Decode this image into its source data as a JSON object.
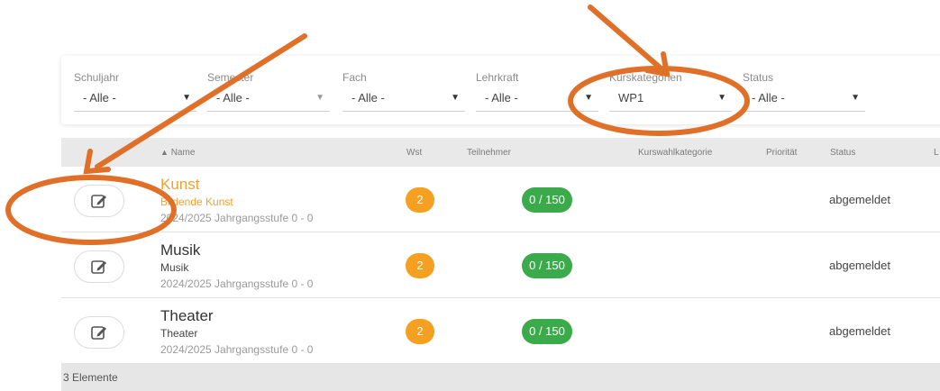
{
  "filters": [
    {
      "label": "Schuljahr",
      "value": "- Alle -"
    },
    {
      "label": "Semester",
      "value": "- Alle -"
    },
    {
      "label": "Fach",
      "value": "- Alle -"
    },
    {
      "label": "Lehrkraft",
      "value": "- Alle -"
    },
    {
      "label": "Kurskategorien",
      "value": "WP1"
    },
    {
      "label": "Status",
      "value": "- Alle -"
    }
  ],
  "table": {
    "headers": {
      "name": "Name",
      "wst": "Wst",
      "teilnehmer": "Teilnehmer",
      "kurswahlkategorie": "Kurswahlkategorie",
      "prioritaet": "Priorität",
      "status": "Status",
      "last": "L"
    },
    "rows": [
      {
        "title": "Kunst",
        "subtitle": "Bildende Kunst",
        "meta": "2024/2025 Jahrgangsstufe 0 - 0",
        "wst": "2",
        "teilnehmer": "0 / 150",
        "status": "abgemeldet"
      },
      {
        "title": "Musik",
        "subtitle": "Musik",
        "meta": "2024/2025 Jahrgangsstufe 0 - 0",
        "wst": "2",
        "teilnehmer": "0 / 150",
        "status": "abgemeldet"
      },
      {
        "title": "Theater",
        "subtitle": "Theater",
        "meta": "2024/2025 Jahrgangsstufe 0 - 0",
        "wst": "2",
        "teilnehmer": "0 / 150",
        "status": "abgemeldet"
      }
    ],
    "footer": "3 Elemente"
  },
  "icons": {
    "edit": "edit-icon",
    "dropdown": "caret-down-icon",
    "sort": "sort-asc-icon"
  },
  "colors": {
    "highlight_text": "#f5a030",
    "wst_badge": "#f5a020",
    "teilnehmer_badge": "#3aaa4a",
    "annotation": "#e07028"
  }
}
